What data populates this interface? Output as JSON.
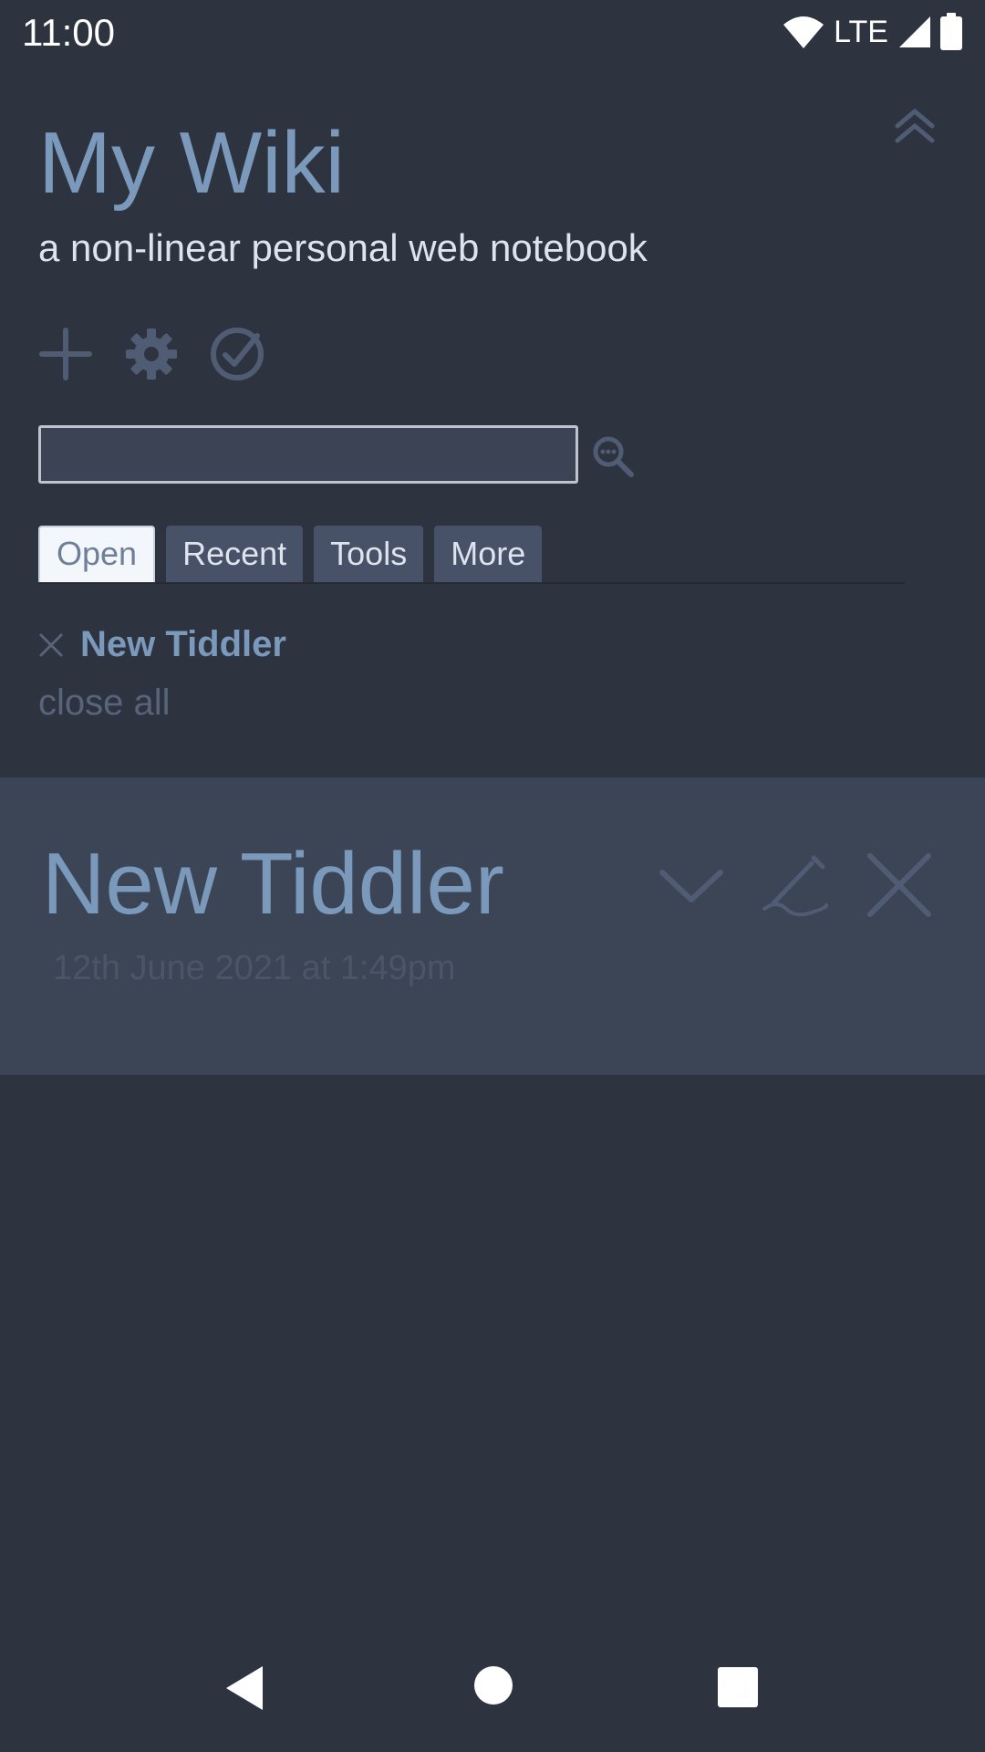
{
  "status_bar": {
    "time": "11:00",
    "network": "LTE"
  },
  "wiki": {
    "title": "My Wiki",
    "subtitle": "a non-linear personal web notebook"
  },
  "toolbar": {
    "icons": [
      "plus-icon",
      "gear-icon",
      "check-circle-icon"
    ]
  },
  "search": {
    "value": "",
    "placeholder": ""
  },
  "tabs": [
    {
      "label": "Open",
      "active": true
    },
    {
      "label": "Recent",
      "active": false
    },
    {
      "label": "Tools",
      "active": false
    },
    {
      "label": "More",
      "active": false
    }
  ],
  "open_list": {
    "items": [
      {
        "title": "New Tiddler"
      }
    ],
    "close_all": "close all"
  },
  "tiddler": {
    "title": "New Tiddler",
    "date": "12th June 2021 at 1:49pm"
  },
  "colors": {
    "background": "#2e3340",
    "accent": "#7a99bb",
    "panel": "#3c4556"
  }
}
